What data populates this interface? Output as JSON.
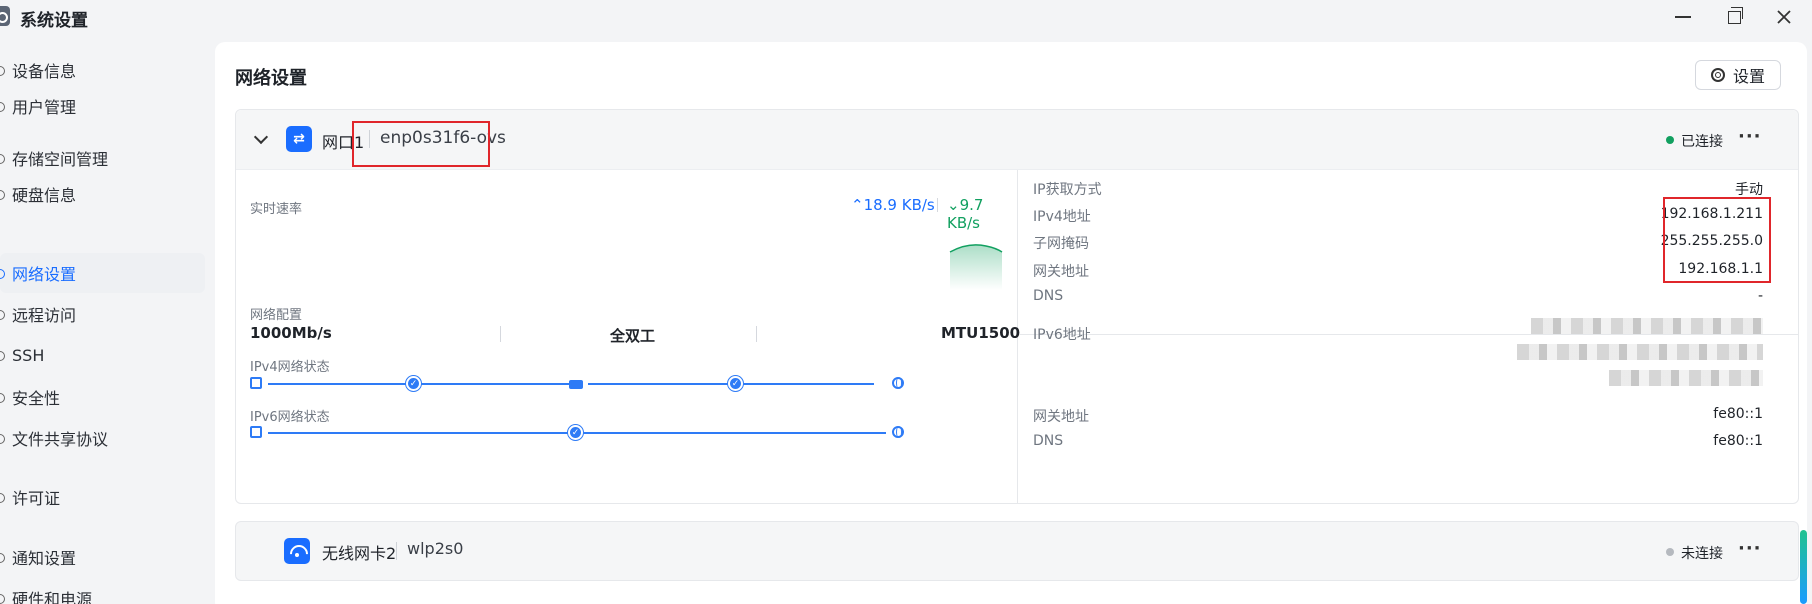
{
  "window": {
    "title": "系统设置"
  },
  "sidebar": {
    "items": [
      {
        "label": "设备信息",
        "active": false
      },
      {
        "label": "用户管理",
        "active": false
      },
      {
        "label": "存储空间管理",
        "active": false
      },
      {
        "label": "硬盘信息",
        "active": false
      },
      {
        "label": "网络设置",
        "active": true
      },
      {
        "label": "远程访问",
        "active": false
      },
      {
        "label": "SSH",
        "active": false
      },
      {
        "label": "安全性",
        "active": false
      },
      {
        "label": "文件共享协议",
        "active": false
      },
      {
        "label": "许可证",
        "active": false
      },
      {
        "label": "通知设置",
        "active": false
      },
      {
        "label": "硬件和电源",
        "active": false
      }
    ]
  },
  "main": {
    "title": "网络设置",
    "settings_label": "设置"
  },
  "iface1": {
    "name": "网口1",
    "device": "enp0s31f6-ovs",
    "status": "已连接",
    "status_color": "#12a060",
    "more": "···",
    "speed_label": "实时速率",
    "upload": "18.9 KB/s",
    "download": "9.7 KB/s",
    "config_label": "网络配置",
    "link_speed": "1000Mb/s",
    "duplex": "全双工",
    "mtu": "MTU1500",
    "ipv4_state_label": "IPv4网络状态",
    "ipv6_state_label": "IPv6网络状态",
    "ipv4": {
      "method_label": "IP获取方式",
      "method": "手动",
      "addr_label": "IPv4地址",
      "addr": "192.168.1.211",
      "mask_label": "子网掩码",
      "mask": "255.255.255.0",
      "gateway_label": "网关地址",
      "gateway": "192.168.1.1",
      "dns_label": "DNS",
      "dns": "-"
    },
    "ipv6": {
      "addr_label": "IPv6地址",
      "gateway_label": "网关地址",
      "gateway": "fe80::1",
      "dns_label": "DNS",
      "dns": "fe80::1"
    }
  },
  "iface2": {
    "name": "无线网卡2",
    "device": "wlp2s0",
    "status": "未连接",
    "status_color": "#b5b9bf",
    "more": "···"
  }
}
